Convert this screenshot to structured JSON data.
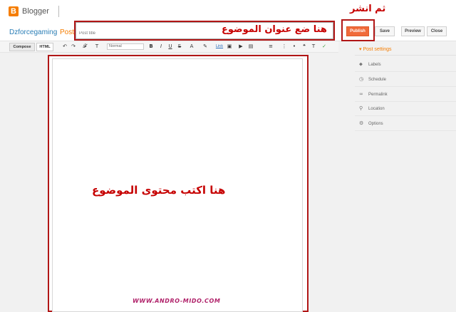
{
  "app": {
    "name": "Blogger",
    "logo_letter": "B"
  },
  "breadcrumb": {
    "blog": "Dzforcegaming",
    "separator": "·",
    "current": "Post"
  },
  "title_field": {
    "placeholder": "Post title",
    "value": ""
  },
  "buttons": {
    "publish": "Publish",
    "save": "Save",
    "preview": "Preview",
    "close": "Close"
  },
  "toolbar": {
    "compose": "Compose",
    "html": "HTML",
    "format_value": "Normal",
    "tools": [
      {
        "name": "undo-icon",
        "glyph": "↶"
      },
      {
        "name": "redo-icon",
        "glyph": "↷"
      },
      {
        "name": "font-family-icon",
        "glyph": "𝓕"
      },
      {
        "name": "font-size-icon",
        "glyph": "T"
      },
      {
        "name": "bold-icon",
        "glyph": "B"
      },
      {
        "name": "italic-icon",
        "glyph": "I"
      },
      {
        "name": "underline-icon",
        "glyph": "U"
      },
      {
        "name": "strikethrough-icon",
        "glyph": "S"
      },
      {
        "name": "text-color-icon",
        "glyph": "A"
      },
      {
        "name": "highlight-icon",
        "glyph": "✎"
      },
      {
        "name": "link-icon",
        "glyph": "Link"
      },
      {
        "name": "image-icon",
        "glyph": "▣"
      },
      {
        "name": "video-icon",
        "glyph": "▶"
      },
      {
        "name": "jump-break-icon",
        "glyph": "▤"
      },
      {
        "name": "align-icon",
        "glyph": "≡"
      },
      {
        "name": "numbered-list-icon",
        "glyph": "⋮"
      },
      {
        "name": "bullet-list-icon",
        "glyph": "•"
      },
      {
        "name": "quote-icon",
        "glyph": "❝"
      },
      {
        "name": "clear-format-icon",
        "glyph": "T"
      },
      {
        "name": "spellcheck-icon",
        "glyph": "✓"
      }
    ]
  },
  "sidebar": {
    "heading": "Post settings",
    "items": [
      {
        "label": "Labels",
        "icon": "label-icon",
        "glyph": "⬥"
      },
      {
        "label": "Schedule",
        "icon": "clock-icon",
        "glyph": "◷"
      },
      {
        "label": "Permalink",
        "icon": "link-icon",
        "glyph": "∞"
      },
      {
        "label": "Location",
        "icon": "location-pin-icon",
        "glyph": "⚲"
      },
      {
        "label": "Options",
        "icon": "gear-icon",
        "glyph": "⚙"
      }
    ]
  },
  "annotations": {
    "publish_hint": "ثم انشر",
    "title_hint": "هنا ضع عنوان الموضوع",
    "content_hint": "هنا اكتب محتوى الموضوع",
    "watermark": "WWW.ANDRO-MIDO.COM"
  },
  "colors": {
    "accent": "#f57d00",
    "publish": "#f06a3a",
    "annotation": "#c60000",
    "watermark": "#b0226a"
  }
}
